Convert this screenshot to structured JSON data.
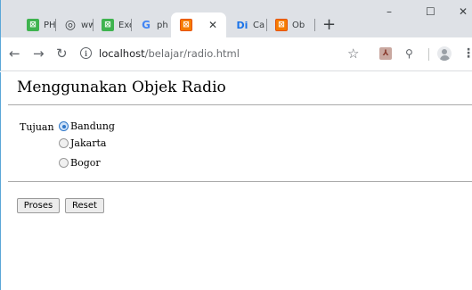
{
  "browser": {
    "tabs": [
      {
        "title": "PH",
        "icon": "xampp-green-icon"
      },
      {
        "title": "ww",
        "icon": "globe-icon"
      },
      {
        "title": "Exe",
        "icon": "xampp-green-icon"
      },
      {
        "title": "ph",
        "icon": "google-icon"
      },
      {
        "title": "",
        "icon": "xampp-icon",
        "active": true
      },
      {
        "title": "Ca",
        "icon": "di-icon"
      },
      {
        "title": "Ob",
        "icon": "xampp-icon"
      }
    ],
    "new_tab": "+",
    "window_controls": {
      "minimize": "–",
      "maximize": "☐",
      "close": "✕"
    },
    "url": {
      "host": "localhost",
      "path": "/belajar/radio.html"
    }
  },
  "page": {
    "title": "Menggunakan Objek Radio",
    "form": {
      "label": "Tujuan",
      "options": [
        {
          "label": "Bandung",
          "checked": true
        },
        {
          "label": "Jakarta",
          "checked": false
        },
        {
          "label": "Bogor",
          "checked": false
        }
      ],
      "submit_label": "Proses",
      "reset_label": "Reset"
    }
  },
  "colors": {
    "chrome_bg": "#dee1e6",
    "radio_accent": "#2f77c8",
    "xampp_green": "#3fb34f",
    "xampp_orange": "#f57c00"
  }
}
